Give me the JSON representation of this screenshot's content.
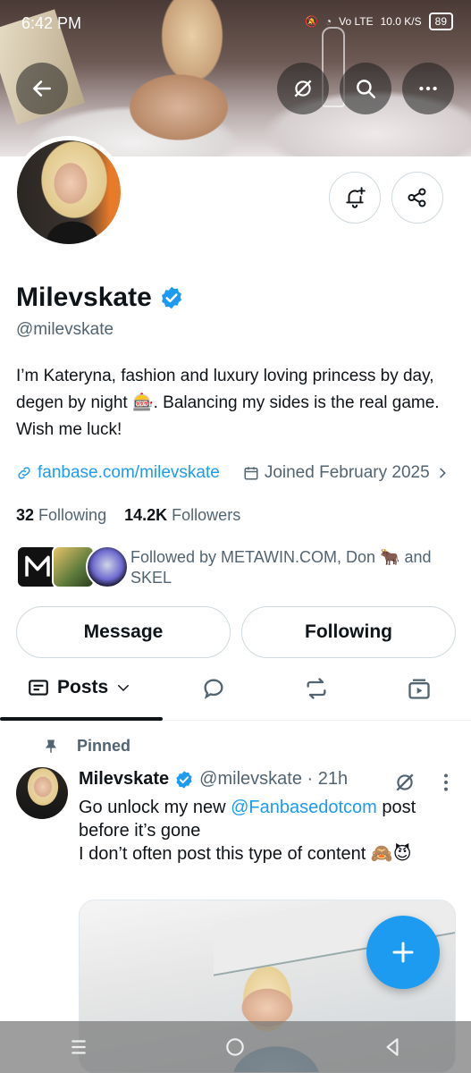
{
  "status_bar": {
    "time": "6:42 PM",
    "network_label": "Vo LTE",
    "speed": "10.0 K/S",
    "battery": "89"
  },
  "profile": {
    "name": "Milevskate",
    "handle": "@milevskate",
    "bio": "I’m Kateryna,  fashion and luxury loving princess by day, degen by night 🎰. Balancing my sides is the real game. Wish me luck!",
    "website": "fanbase.com/milevskate",
    "joined": "Joined February 2025",
    "following_count": "32",
    "following_label": "Following",
    "followers_count": "14.2K",
    "followers_label": "Followers",
    "followed_by": "Followed by METAWIN.COM, Don 🐂 and SKEL"
  },
  "actions": {
    "message": "Message",
    "following": "Following"
  },
  "tabs": {
    "posts": "Posts"
  },
  "post": {
    "pinned_label": "Pinned",
    "name": "Milevskate",
    "handle_time": "@milevskate · 21h",
    "text_part1": "Go unlock my new ",
    "mention": "@Fanbasedotcom",
    "text_part2": " post before it’s gone",
    "text_line2": "I don’t often post this type of content 🙈😈"
  },
  "colors": {
    "accent": "#1d9bf0",
    "secondary_text": "#536471",
    "primary_text": "#0f1419"
  }
}
